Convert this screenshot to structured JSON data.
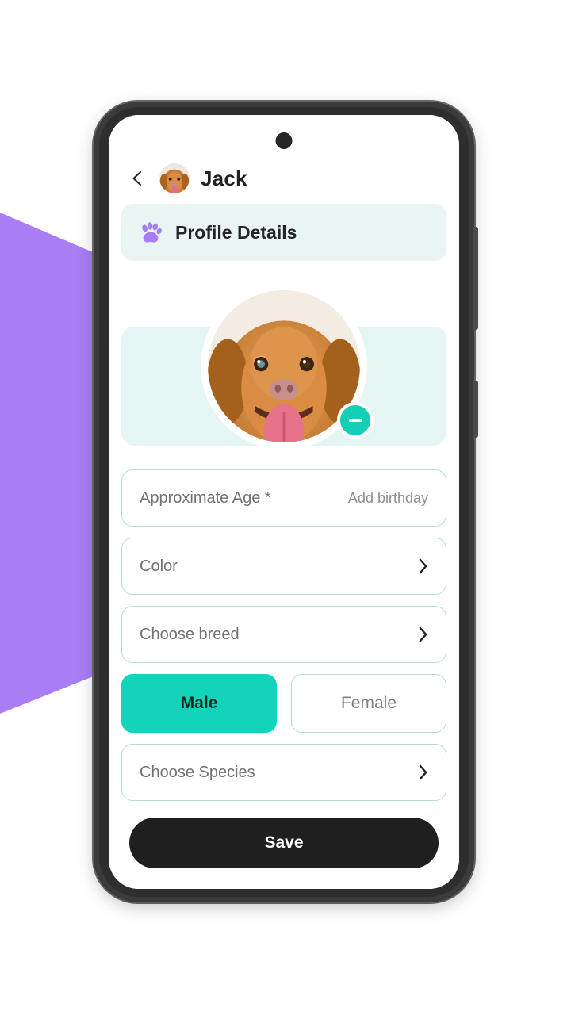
{
  "background": {
    "page_color": "#ffffff",
    "accent_purple": "#a97ef5"
  },
  "device": {
    "frame_color": "#3b3b3b",
    "screen_color": "#ffffff",
    "camera_label": "punch-hole-camera",
    "buttons": [
      {
        "name": "volume-rocker"
      },
      {
        "name": "power-button"
      }
    ]
  },
  "header": {
    "back_icon": "chevron-left-icon",
    "avatar_alt": "pet-avatar",
    "title": "Jack"
  },
  "section": {
    "icon": "paw-icon",
    "icon_color": "#a97ef5",
    "title": "Profile Details",
    "background": "#e9f5f3"
  },
  "photo": {
    "alt": "pet-photo",
    "banner_color": "#e4f5f3",
    "remove_badge": {
      "icon": "minus-icon",
      "color": "#13cfb6"
    }
  },
  "form": {
    "fields": [
      {
        "label": "Approximate Age *",
        "action_text": "Add birthday",
        "has_chevron": false,
        "name": "approximate-age-field"
      },
      {
        "label": "Color",
        "action_text": "",
        "has_chevron": true,
        "name": "color-field"
      },
      {
        "label": "Choose breed",
        "action_text": "",
        "has_chevron": true,
        "name": "choose-breed-field"
      }
    ],
    "gender": {
      "options": [
        {
          "label": "Male",
          "selected": true
        },
        {
          "label": "Female",
          "selected": false
        }
      ],
      "selected_color": "#12d4ba",
      "border_color": "#b9dcd6"
    },
    "species_field": {
      "label": "Choose Species",
      "has_chevron": true
    }
  },
  "footer": {
    "save_label": "Save",
    "save_color": "#1f1f20"
  }
}
